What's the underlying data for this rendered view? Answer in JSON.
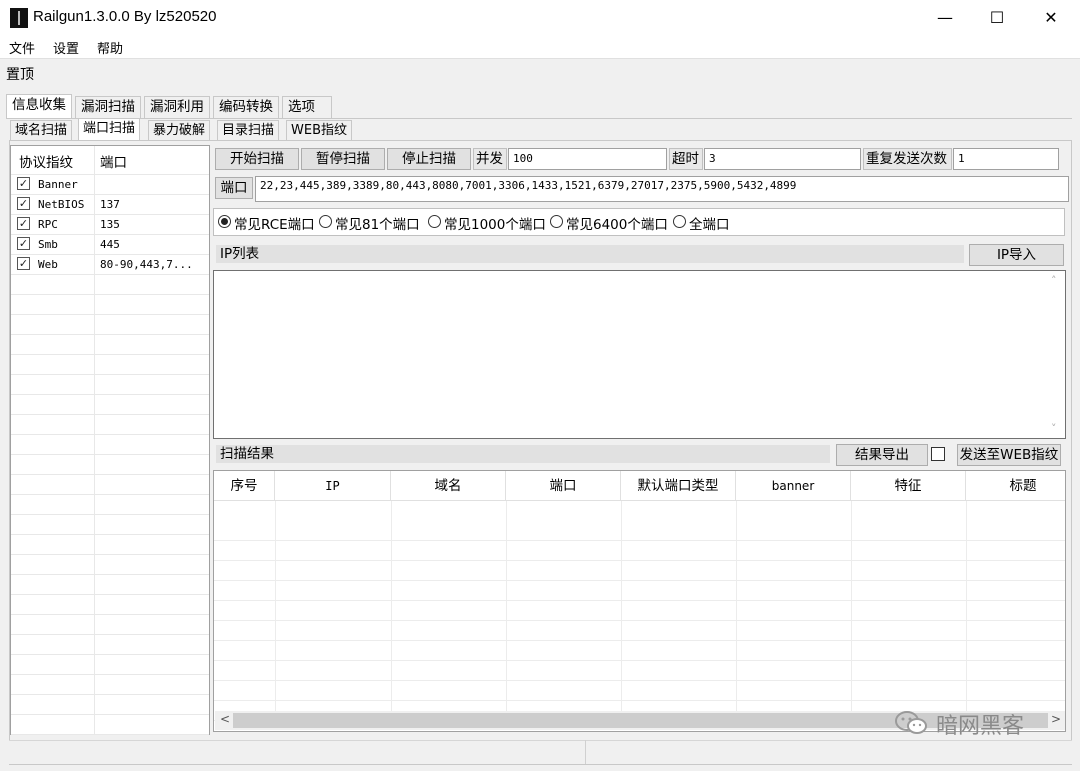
{
  "window": {
    "title": "Railgun1.3.0.0 By lz520520",
    "minimize": "—",
    "maximize": "☐",
    "close": "✕"
  },
  "menu": [
    "文件",
    "设置",
    "帮助"
  ],
  "pin": "置顶",
  "main_tabs": [
    "信息收集",
    "漏洞扫描",
    "漏洞利用",
    "编码转换",
    "选项"
  ],
  "sub_tabs": [
    "域名扫描",
    "端口扫描",
    "暴力破解",
    "目录扫描",
    "WEB指纹"
  ],
  "protocol_list": {
    "headers": [
      "协议指纹",
      "端口"
    ],
    "rows": [
      {
        "name": "Banner",
        "port": "",
        "checked": true
      },
      {
        "name": "NetBIOS",
        "port": "137",
        "checked": true
      },
      {
        "name": "RPC",
        "port": "135",
        "checked": true
      },
      {
        "name": "Smb",
        "port": "445",
        "checked": true
      },
      {
        "name": "Web",
        "port": "80-90,443,7...",
        "checked": true
      }
    ]
  },
  "controls": {
    "start": "开始扫描",
    "pause": "暂停扫描",
    "stop": "停止扫描",
    "concurrency_label": "并发",
    "concurrency_value": "100",
    "timeout_label": "超时",
    "timeout_value": "3",
    "retry_label": "重复发送次数",
    "retry_value": "1",
    "port_label": "端口",
    "port_value": "22,23,445,389,3389,80,443,8080,7001,3306,1433,1521,6379,27017,2375,5900,5432,4899"
  },
  "port_presets": [
    {
      "label": "常见RCE端口",
      "selected": true
    },
    {
      "label": "常见81个端口",
      "selected": false
    },
    {
      "label": "常见1000个端口",
      "selected": false
    },
    {
      "label": "常见6400个端口",
      "selected": false
    },
    {
      "label": "全端口",
      "selected": false
    }
  ],
  "ip_section": {
    "title": "IP列表",
    "import": "IP导入"
  },
  "results_section": {
    "title": "扫描结果",
    "export": "结果导出",
    "send": "发送至WEB指纹"
  },
  "results_table": {
    "columns": [
      "序号",
      "IP",
      "域名",
      "端口",
      "默认端口类型",
      "banner",
      "特征",
      "标题"
    ]
  },
  "scroll": {
    "up": "˄",
    "down": "˅",
    "left": "<",
    "right": ">"
  },
  "watermark": "暗网黑客",
  "check_mark": "✓"
}
